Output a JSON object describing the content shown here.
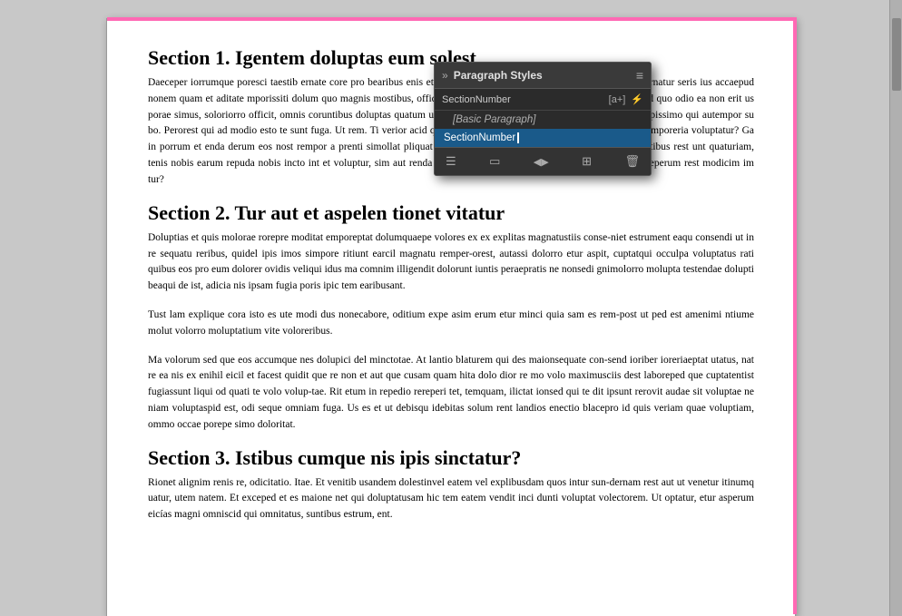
{
  "document": {
    "page_border_color": "#ff69b4",
    "sections": [
      {
        "id": "section1",
        "heading": "Section 1.   Igentem doluptas eum solest",
        "body": "Daeceper iorrumque poresci taestib ernate core pro bearibus enis et, cu quam qui rat fuga. Apelestem aut ut etum facernatur seris ius accaepud nonem quam et aditate mporissiti dolum quo magnis mostibus, officiet quos doluptia soluptae dem ea nonsequi dolesed quo odio ea non erit us porae simus, soloriorro officit, omnis coruntibus doluptas quatum ute p volorem quo velest, cum nust, sant autem verspissimo qui autempor su bo. Perorest qui ad modio esto te sunt fuga. Ut rem. Ti verior acid quo l quibus experibusae. Explignis a natus eturiat emporeria voluptatur? Ga in porrum et enda derum eos nost rempor a prenti simollat pliquat ener descidemquia nobis elestis idenda corpore estibus rest unt quaturiam, tenis nobis earum repuda nobis incto int et voluptur, sim aut renda aut Urerum exceped earibus, quam facidio eum ereperum rest modicim im tur?"
      },
      {
        "id": "section2",
        "heading": "Section 2.   Tur aut et aspelen tionet vitatur",
        "body1": "Doluptias et quis molorae rorepre moditat emporeptat dolumquaepe volores ex ex explitas magnatustiis conse-niet estrument eaqu consendi ut in re sequatu reribus, quidel ipis imos simpore ritiunt earcil magnatu remper-orest, autassi dolorro etur aspit, cuptatqui occulpa voluptatus rati quibus eos pro eum dolorer ovidis veliqui idus ma comnim illigendit dolorunt iuntis peraepratis ne nonsedi gnimolorro molupta testendae dolupti beaqui de ist, adicia nis ipsam fugia poris ipic tem earibusant.",
        "body2": "Tust lam explique cora isto es ute modi dus nonecabore, oditium expe asim erum etur minci quia sam es rem-post ut ped est amenimi ntiume molut volorro moluptatium vite voloreribus.",
        "body3": "Ma volorum sed que eos accumque nes dolupici del minctotae. At lantio blaturem qui des maionsequate con-send ioriber ioreriaeptat utatus, nat re ea nis ex enihil eicil et facest quidit que re non et aut que cusam quam hita dolo dior re mo volo maximusciis dest laboreped que cuptatentist fugiassunt liqui od quati te volo volup-tae. Rit etum in repedio rereperi tet, temquam, ilictat ionsed qui te dit ipsunt rerovit audae sit voluptae ne niam voluptaspid est, odi seque omniam fuga. Us es et ut debisqu idebitas solum rent landios enectio blacepro id quis veriam quae voluptiam, ommo occae porepe simo doloritat."
      },
      {
        "id": "section3",
        "heading": "Section 3.   Istibus cumque nis ipis sinctatur?",
        "body": "Rionet alignim renis re, odicitatio. Itae. Et venitib usandem dolestinvel eatem vel explibusdam quos intur sun-dernam rest aut ut venetur itinumq uatur, utem natem. Et exceped et es maione net qui doluptatusam hic tem eatem vendit inci dunti voluptat volectorem. Ut optatur, etur asperum eicías magni omniscid qui omnitatus, suntibus estrum, ent."
      }
    ]
  },
  "panel": {
    "title": "Paragraph Styles",
    "double_arrow_icon": "»",
    "menu_icon": "≡",
    "search_row_label": "SectionNumber",
    "add_style_icon": "[a+]",
    "lightning_icon": "⚡",
    "items": [
      {
        "id": "basic-paragraph",
        "label": "[Basic Paragraph]",
        "selected": false,
        "sub": true
      },
      {
        "id": "section-number",
        "label": "SectionNumber",
        "selected": true,
        "sub": false
      }
    ],
    "footer_icons": [
      {
        "name": "create-new-style",
        "symbol": "☰",
        "title": "Create new style"
      },
      {
        "name": "load-styles",
        "symbol": "▭",
        "title": "Load paragraph styles"
      },
      {
        "name": "redefine-style",
        "symbol": "◀",
        "title": "Redefine style"
      },
      {
        "name": "clear-overrides",
        "symbol": "⊡",
        "title": "Clear overrides"
      },
      {
        "name": "delete-style",
        "symbol": "🗑",
        "title": "Delete selected styles"
      }
    ]
  }
}
